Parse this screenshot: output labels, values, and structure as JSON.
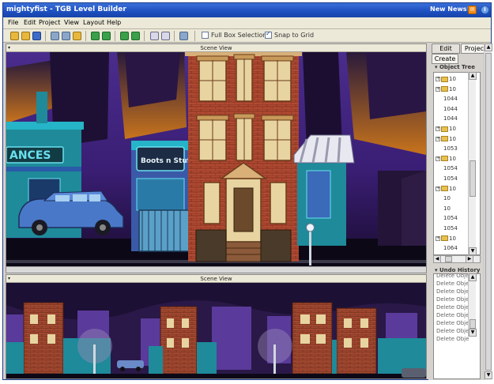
{
  "window": {
    "title": "mightyfist - TGB Level Builder",
    "news": "New News!"
  },
  "menu": [
    "File",
    "Edit",
    "Project",
    "View",
    "Layout",
    "Help"
  ],
  "toolbar": {
    "full_box_selection": {
      "label": "Full Box Selection",
      "checked": false
    },
    "snap_to_grid": {
      "label": "Snap to Grid",
      "checked": true
    }
  },
  "scene_top": {
    "label": "Scene View"
  },
  "scene_bottom": {
    "label": "Scene View"
  },
  "scene_art": {
    "signs": [
      "ANCES",
      "Boots n Stuff"
    ]
  },
  "right_panel": {
    "tabs": [
      "Edit",
      "Project"
    ],
    "active_tab": "Project",
    "create_tab": "Create",
    "object_tree_title": "Object Tree",
    "tree_rows": [
      {
        "label": "10",
        "folder": true
      },
      {
        "label": "10",
        "folder": true
      },
      {
        "label": "1044",
        "folder": false
      },
      {
        "label": "1044",
        "folder": false
      },
      {
        "label": "1044",
        "folder": false
      },
      {
        "label": "10",
        "folder": true
      },
      {
        "label": "10",
        "folder": true
      },
      {
        "label": "1053",
        "folder": false
      },
      {
        "label": "10",
        "folder": true
      },
      {
        "label": "1054",
        "folder": false
      },
      {
        "label": "1054",
        "folder": false
      },
      {
        "label": "10",
        "folder": true
      },
      {
        "label": "10",
        "folder": false
      },
      {
        "label": "10",
        "folder": false
      },
      {
        "label": "1054",
        "folder": false
      },
      {
        "label": "1054",
        "folder": false
      },
      {
        "label": "10",
        "folder": true
      },
      {
        "label": "1064",
        "folder": false
      }
    ],
    "undo_title": "Undo History",
    "undo_rows": [
      "Delete Obje",
      "Delete Obje",
      "Delete Obje",
      "Delete Obje",
      "Delete Obje",
      "Delete Obje",
      "Delete Obje",
      "Delete Obje",
      "Delete Obje"
    ]
  }
}
